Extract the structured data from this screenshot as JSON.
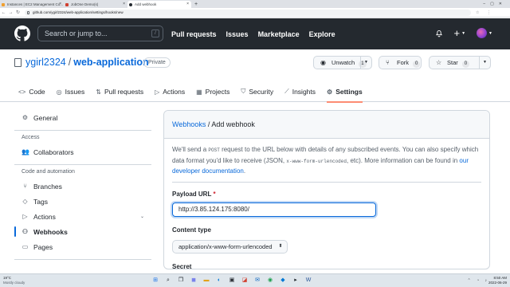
{
  "browser": {
    "tabs": [
      {
        "title": "Instances | EC2 Management Co...",
        "active": false
      },
      {
        "title": "JobOne Demo(s)",
        "active": false
      },
      {
        "title": "Add webhook",
        "active": true
      }
    ],
    "url": "github.com/ygirl2324/web-application/settings/hooks/new"
  },
  "gh": {
    "search_placeholder": "Search or jump to...",
    "search_key": "/",
    "nav": [
      "Pull requests",
      "Issues",
      "Marketplace",
      "Explore"
    ]
  },
  "repo": {
    "owner": "ygirl2324",
    "separator": "/",
    "name": "web-application",
    "visibility": "Private",
    "unwatch_label": "Unwatch",
    "unwatch_count": "1",
    "fork_label": "Fork",
    "fork_count": "0",
    "star_label": "Star",
    "star_count": "0",
    "tabs": [
      "Code",
      "Issues",
      "Pull requests",
      "Actions",
      "Projects",
      "Security",
      "Insights",
      "Settings"
    ]
  },
  "sidebar": {
    "general": "General",
    "access_heading": "Access",
    "collaborators": "Collaborators",
    "code_heading": "Code and automation",
    "branches": "Branches",
    "tags": "Tags",
    "actions": "Actions",
    "webhooks": "Webhooks",
    "pages": "Pages"
  },
  "main": {
    "breadcrumb_link": "Webhooks",
    "breadcrumb_current": "/ Add webhook",
    "intro_1": "We'll send a",
    "intro_post": "POST",
    "intro_2": "request to the URL below with details of any subscribed events. You can also specify which data format you'd like to receive (JSON,",
    "intro_code": "x-www-form-urlencoded",
    "intro_3": ", etc). More information can be found in",
    "intro_link": "our developer documentation",
    "intro_end": ".",
    "payload_label": "Payload URL",
    "required_mark": "*",
    "payload_value": "http://3.85.124.175:8080/",
    "content_type_label": "Content type",
    "content_type_value": "application/x-www-form-urlencoded",
    "secret_label": "Secret"
  },
  "taskbar": {
    "temp": "19°C",
    "weather": "Mostly cloudy",
    "time": "8:50 AM",
    "date": "2022-06-29"
  }
}
